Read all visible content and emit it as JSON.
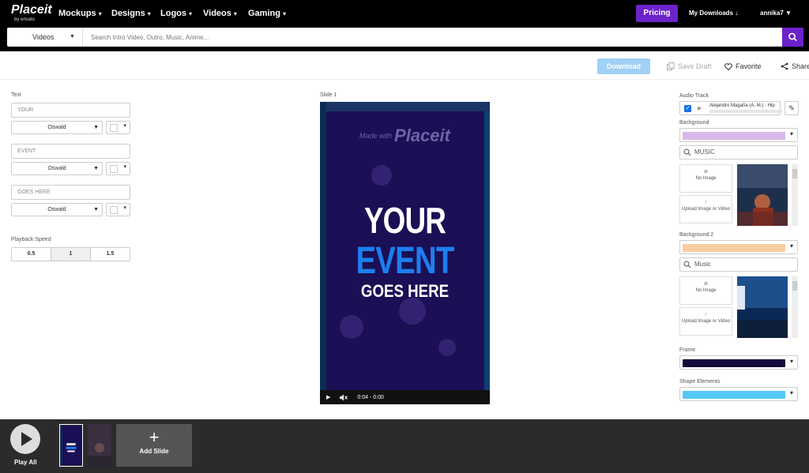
{
  "brand": {
    "logo": "Placeit",
    "sub": "by envato"
  },
  "nav": {
    "items": [
      "Mockups",
      "Designs",
      "Logos",
      "Videos",
      "Gaming"
    ],
    "pricing": "Pricing",
    "my_downloads": "My Downloads",
    "user": "annika7"
  },
  "search": {
    "category": "Videos",
    "placeholder": "Search Intro Video, Outro, Music, Anime..."
  },
  "actions": {
    "download": "Download",
    "save_draft": "Save Draft",
    "favorite": "Favorite",
    "share": "Share"
  },
  "left_panel": {
    "text_label": "Text",
    "fields": [
      {
        "value": "YOUR",
        "font": "Oswald"
      },
      {
        "value": "EVENT",
        "font": "Oswald"
      },
      {
        "value": "GOES HERE",
        "font": "Oswald"
      }
    ],
    "speed_label": "Playback Speed",
    "speeds": [
      "0.5",
      "1",
      "1.5"
    ],
    "selected_speed": "1"
  },
  "preview": {
    "slide_label": "Slide 1",
    "watermark_small": "Made with",
    "watermark_big": "Placeit",
    "line1": "YOUR",
    "line2": "EVENT",
    "line3": "GOES HERE",
    "time": "0:04 - 0:00"
  },
  "right_panel": {
    "audio_label": "Audio Track",
    "audio_title": "Alejandro Magaña (A. M.) - Hip",
    "background_label": "Background",
    "background_color": "#d8b8e8",
    "search1": "MUSIC",
    "no_image": "No Image",
    "upload": "Upload Image or Video",
    "background2_label": "Background 2",
    "background2_color": "#f9ce9e",
    "search2": "Music",
    "frame_label": "Frame",
    "frame_color": "#14093d",
    "shape_label": "Shape Elements",
    "shape_color": "#55c8f5",
    "partial_color": "#1b3a6e"
  },
  "bottom": {
    "play_all": "Play All",
    "add_slide": "Add Slide"
  }
}
